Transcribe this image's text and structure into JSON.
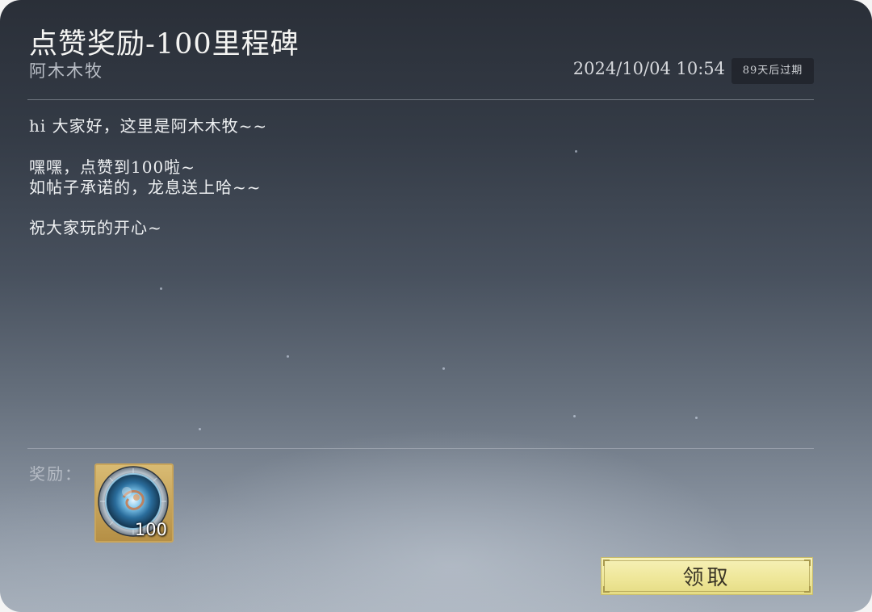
{
  "mail": {
    "title": "点赞奖励-100里程碑",
    "sender": "阿木木牧",
    "date": "2024/10/04 10:54",
    "expiry": "89天后过期",
    "body_lines": [
      "hi 大家好，这里是阿木木牧~~",
      "嘿嘿，点赞到100啦~",
      "如帖子承诺的，龙息送上哈~~",
      "祝大家玩的开心~"
    ]
  },
  "reward": {
    "label": "奖励：",
    "items": [
      {
        "icon": "dragon-breath-orb-icon",
        "quantity": "100"
      }
    ]
  },
  "actions": {
    "claim_label": "领取"
  },
  "colors": {
    "claim_button": "#f0e89c",
    "reward_frame": "#c9a55a"
  }
}
